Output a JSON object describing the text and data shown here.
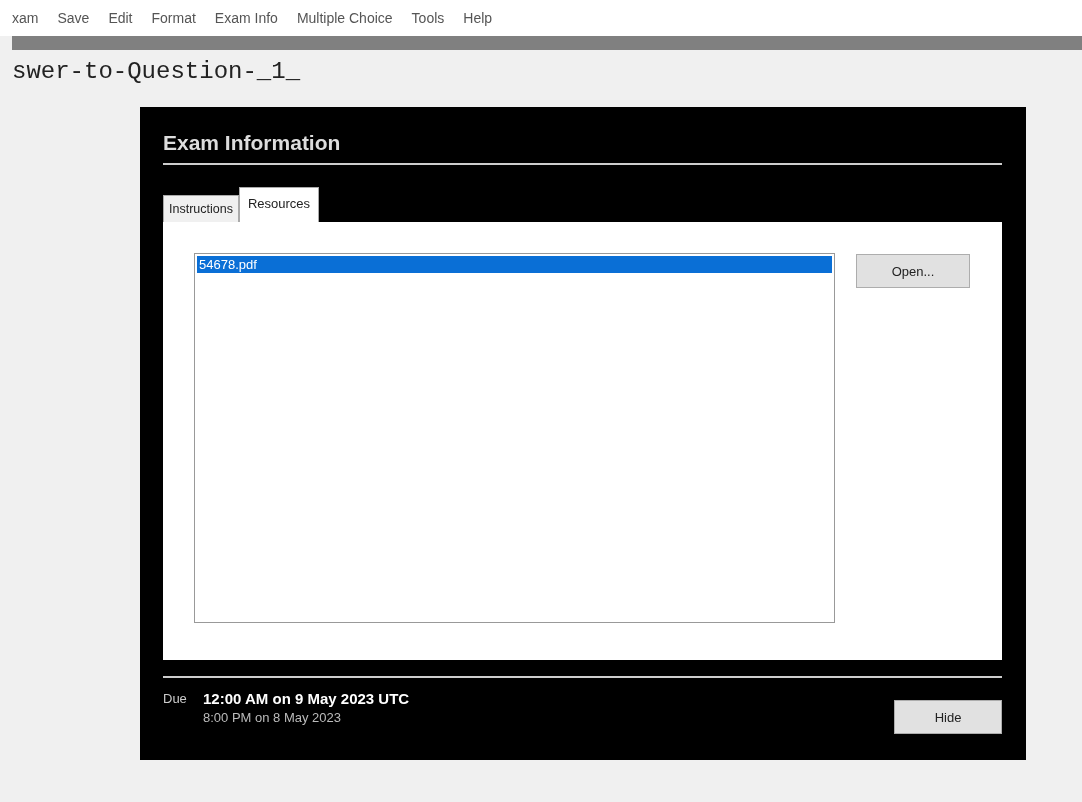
{
  "menu": [
    "xam",
    "Save",
    "Edit",
    "Format",
    "Exam Info",
    "Multiple Choice",
    "Tools",
    "Help"
  ],
  "document_title": "swer-to-Question-_1_",
  "dialog": {
    "title": "Exam Information",
    "tabs": [
      {
        "label": "Instructions",
        "selected": false
      },
      {
        "label": "Resources",
        "selected": true
      }
    ],
    "files": [
      {
        "name": "54678.pdf",
        "selected": true
      }
    ],
    "open_button": "Open...",
    "due_label": "Due",
    "due_utc": "12:00 AM on 9 May 2023 UTC",
    "due_local": "8:00 PM on 8 May 2023",
    "hide_button": "Hide"
  }
}
